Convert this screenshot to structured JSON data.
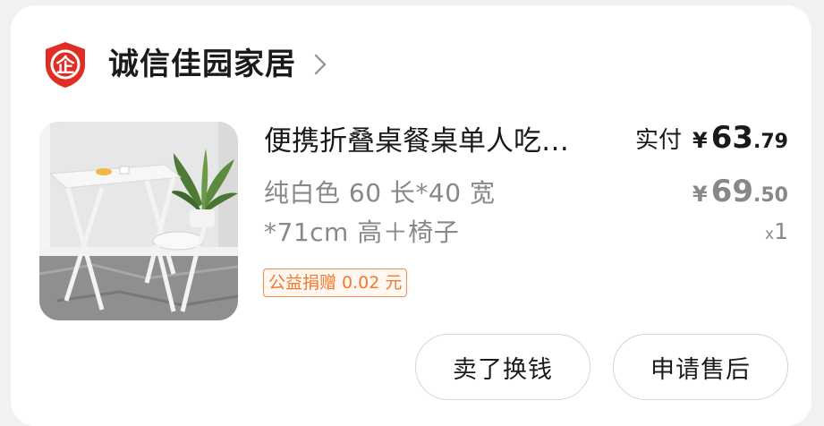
{
  "shop": {
    "name": "诚信佳园家居",
    "badge_icon": "enterprise-shield-icon",
    "badge_text": "企",
    "badge_color": "#e02e24",
    "chevron_icon": "chevron-right-icon"
  },
  "product": {
    "title": "便携折叠桌餐桌单人吃…",
    "spec_line1": "纯白色 60 长*40 宽",
    "spec_line2": "*71cm 高＋椅子",
    "image_icon": "product-photo-folding-table-chair"
  },
  "price": {
    "paid_label": "实付",
    "paid_symbol": "¥",
    "paid_int": "63",
    "paid_dec": ".79",
    "original_symbol": "¥",
    "original_int": "69",
    "original_dec": ".50",
    "qty_x": "x",
    "qty_n": "1"
  },
  "charity": {
    "text": "公益捐赠 0.02 元",
    "color": "#f07a2e"
  },
  "actions": {
    "resell_label": "卖了换钱",
    "aftersale_label": "申请售后"
  }
}
